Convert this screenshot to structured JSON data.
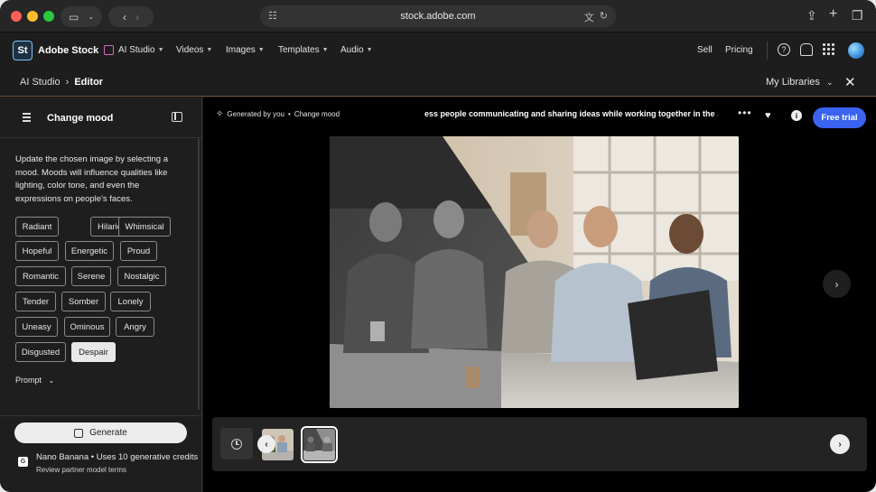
{
  "browser": {
    "url": "stock.adobe.com"
  },
  "header": {
    "brand": "Adobe Stock",
    "logo_text": "St",
    "nav": [
      "AI Studio",
      "Videos",
      "Images",
      "Templates",
      "Audio"
    ],
    "sell": "Sell",
    "pricing": "Pricing"
  },
  "breadcrumb": {
    "parent": "AI Studio",
    "current": "Editor",
    "libraries": "My Libraries"
  },
  "panel": {
    "title": "Change mood",
    "description": "Update the chosen image by selecting a mood. Moods will influence qualities like lighting, color tone, and even the expressions on people's faces.",
    "moods": [
      "Radiant",
      "Hilarious",
      "Whimsical",
      "Hopeful",
      "Energetic",
      "Proud",
      "Romantic",
      "Serene",
      "Nostalgic",
      "Tender",
      "Somber",
      "Lonely",
      "Uneasy",
      "Ominous",
      "Angry",
      "Disgusted",
      "Despair"
    ],
    "selected_mood": "Despair",
    "prompt_label": "Prompt",
    "generate_label": "Generate",
    "model_info": "Nano Banana • Uses 10 generative credits",
    "terms": "Review partner model terms"
  },
  "canvas": {
    "generated_by": "Generated by you",
    "operation": "Change mood",
    "image_title": "ess people communicating and sharing ideas while working together in the ...",
    "free_trial": "Free trial"
  },
  "colors": {
    "accent": "#3b63f0",
    "background": "#1b1b1b"
  }
}
